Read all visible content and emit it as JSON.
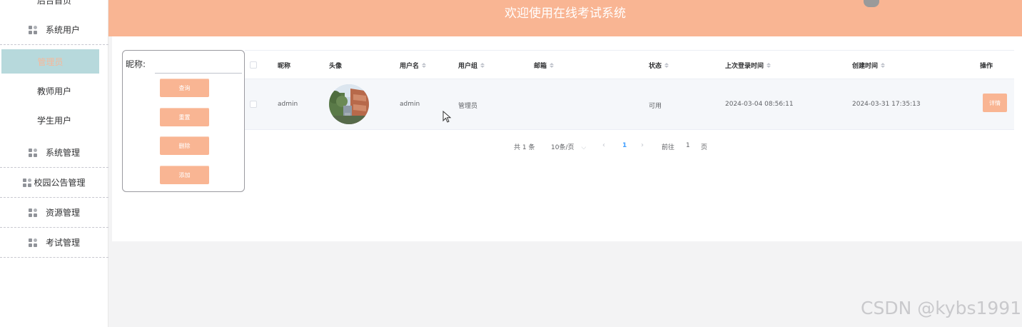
{
  "header": {
    "title": "欢迎使用在线考试系统"
  },
  "sidebar": {
    "home": "后台首页",
    "groups": [
      {
        "label": "系统用户"
      },
      {
        "label": "系统管理"
      },
      {
        "label": "校园公告管理"
      },
      {
        "label": "资源管理"
      },
      {
        "label": "考试管理"
      }
    ],
    "subitems": [
      {
        "label": "管理员",
        "active": true
      },
      {
        "label": "教师用户"
      },
      {
        "label": "学生用户"
      }
    ]
  },
  "search": {
    "label": "昵称:",
    "placeholder": "",
    "value": "",
    "buttons": {
      "query": "查询",
      "reset": "重置",
      "delete": "删除",
      "add": "添加"
    }
  },
  "table": {
    "columns": {
      "nickname": "昵称",
      "avatar": "头像",
      "username": "用户名",
      "group": "用户组",
      "email": "邮箱",
      "status": "状态",
      "last_login": "上次登录时间",
      "created": "创建时间",
      "actions": "操作"
    },
    "rows": [
      {
        "nickname": "admin",
        "username": "admin",
        "group": "管理员",
        "email": "",
        "status": "可用",
        "last_login": "2024-03-04 08:56:11",
        "created": "2024-03-31 17:35:13",
        "action": "详情"
      }
    ]
  },
  "pagination": {
    "total": "共 1 条",
    "page_size": "10条/页",
    "current_page": "1",
    "goto_label": "前往",
    "goto_value": "1",
    "page_suffix": "页"
  },
  "watermark": "CSDN @kybs1991",
  "colors": {
    "accent": "#f9b593",
    "active_bg": "#b7d9dc"
  }
}
